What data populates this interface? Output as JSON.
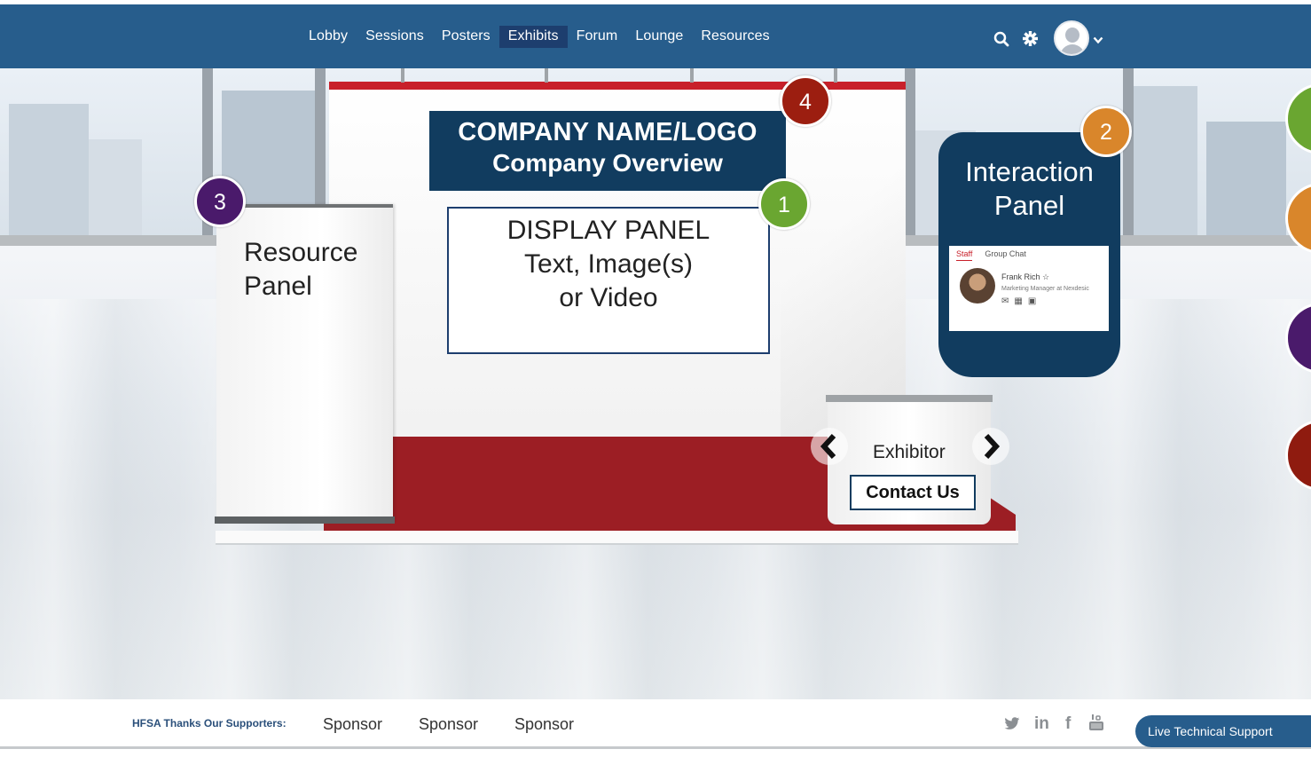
{
  "nav": {
    "items": [
      {
        "label": "Lobby",
        "active": false
      },
      {
        "label": "Sessions",
        "active": false
      },
      {
        "label": "Posters",
        "active": false
      },
      {
        "label": "Exhibits",
        "active": true
      },
      {
        "label": "Forum",
        "active": false
      },
      {
        "label": "Lounge",
        "active": false
      },
      {
        "label": "Resources",
        "active": false
      }
    ],
    "icons": [
      "search-icon",
      "gear-icon",
      "user-avatar",
      "chevron-down-icon"
    ]
  },
  "booth": {
    "company_name": "COMPANY NAME/LOGO",
    "company_overview": "Company Overview",
    "display_panel": {
      "line1": "DISPLAY PANEL",
      "line2": "Text, Image(s)",
      "line3": "or Video"
    },
    "resource_panel": {
      "line1": "Resource",
      "line2": "Panel"
    },
    "exhibitor_label": "Exhibitor",
    "contact_button": "Contact Us",
    "prev_arrow": "‹",
    "next_arrow": "›"
  },
  "interaction_panel": {
    "line1": "Interaction",
    "line2": "Panel",
    "chat": {
      "tab_staff": "Staff",
      "tab_group": "Group Chat",
      "name": "Frank Rich ☆",
      "role": "Marketing Manager at Nexdesic"
    }
  },
  "callouts": [
    {
      "number": "1",
      "color": "#6aa631"
    },
    {
      "number": "2",
      "color": "#d9862b"
    },
    {
      "number": "3",
      "color": "#4a1a6b"
    },
    {
      "number": "4",
      "color": "#9c1e10"
    }
  ],
  "side_circles": [
    "#6aa631",
    "#d9862b",
    "#4a1a6b",
    "#8f1b0f"
  ],
  "footer": {
    "supporters_label": "HFSA Thanks Our Supporters:",
    "sponsors": [
      "Sponsor",
      "Sponsor",
      "Sponsor"
    ],
    "social": {
      "twitter": "🐦",
      "linkedin": "in",
      "facebook": "f",
      "youtube": "▣"
    },
    "live_support": "Live Technical Support"
  },
  "colors": {
    "nav_bg": "#275d8c",
    "nav_active": "#1d3e6e",
    "booth_navy": "#113c5f",
    "booth_red": "#9c1e24"
  }
}
